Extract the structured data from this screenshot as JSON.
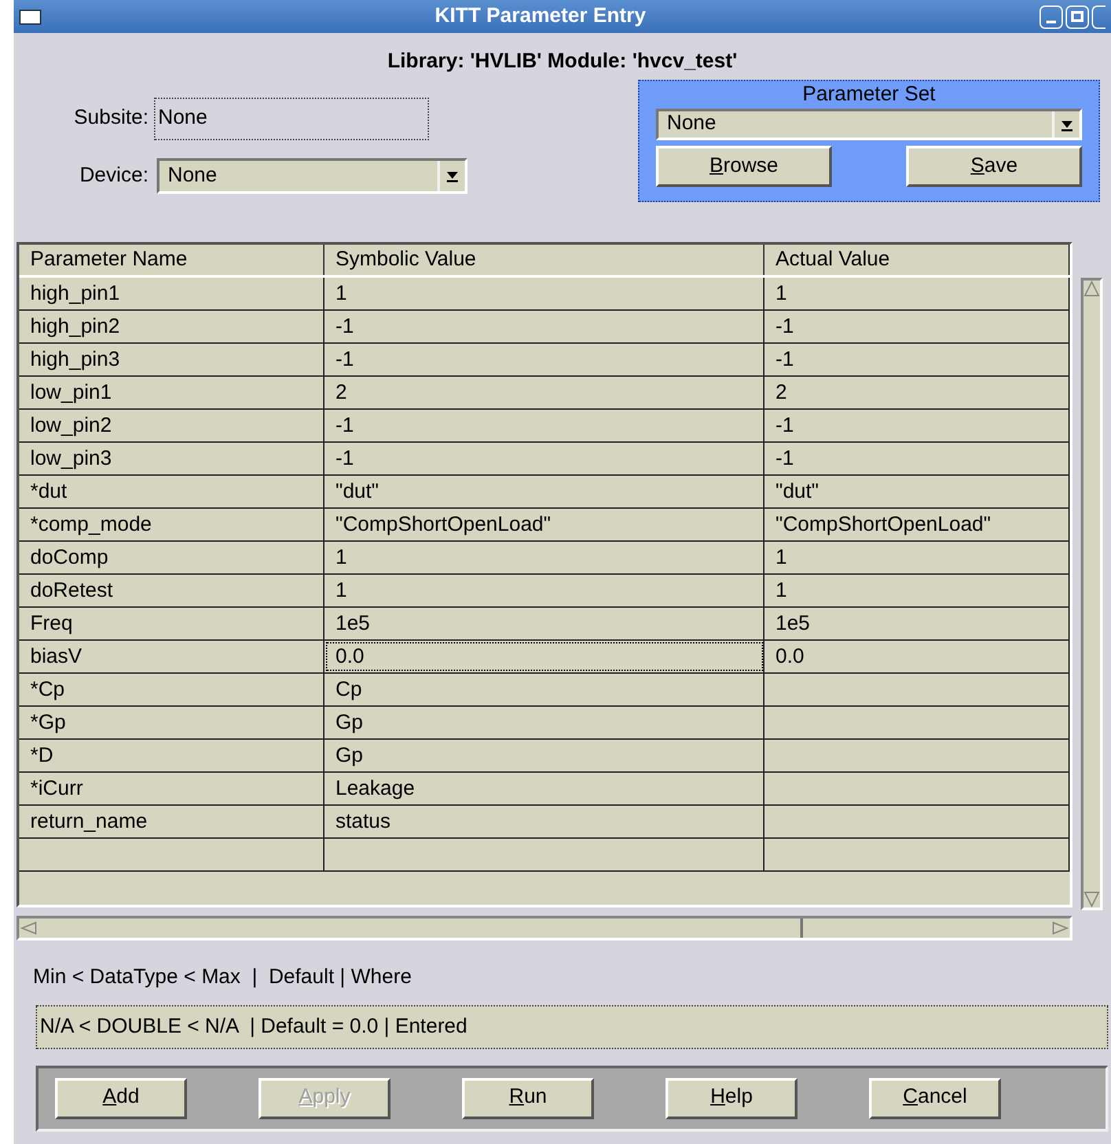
{
  "window": {
    "title": "KITT Parameter Entry"
  },
  "header": "Library: 'HVLIB'  Module: 'hvcv_test'",
  "subsite": {
    "label": "Subsite:",
    "value": "None"
  },
  "device": {
    "label": "Device:",
    "value": "None"
  },
  "parameter_set": {
    "title": "Parameter Set",
    "value": "None",
    "buttons": [
      {
        "label": "Browse"
      },
      {
        "label": "Save"
      }
    ]
  },
  "table": {
    "columns": [
      "Parameter Name",
      "Symbolic Value",
      "Actual Value"
    ],
    "rows": [
      {
        "cells": [
          "high_pin1",
          "1",
          "1"
        ],
        "focused": false
      },
      {
        "cells": [
          "high_pin2",
          "-1",
          "-1"
        ],
        "focused": false
      },
      {
        "cells": [
          "high_pin3",
          "-1",
          "-1"
        ],
        "focused": false
      },
      {
        "cells": [
          "low_pin1",
          "2",
          "2"
        ],
        "focused": false
      },
      {
        "cells": [
          "low_pin2",
          "-1",
          "-1"
        ],
        "focused": false
      },
      {
        "cells": [
          "low_pin3",
          "-1",
          "-1"
        ],
        "focused": false
      },
      {
        "cells": [
          "*dut",
          "\"dut\"",
          "\"dut\""
        ],
        "focused": false
      },
      {
        "cells": [
          "*comp_mode",
          "\"CompShortOpenLoad\"",
          "\"CompShortOpenLoad\""
        ],
        "focused": false
      },
      {
        "cells": [
          "doComp",
          "1",
          "1"
        ],
        "focused": false
      },
      {
        "cells": [
          "doRetest",
          "1",
          "1"
        ],
        "focused": false
      },
      {
        "cells": [
          "Freq",
          "1e5",
          "1e5"
        ],
        "focused": false
      },
      {
        "cells": [
          "biasV",
          "0.0",
          "0.0"
        ],
        "focused": true
      },
      {
        "cells": [
          "*Cp",
          "Cp",
          ""
        ],
        "focused": false
      },
      {
        "cells": [
          "*Gp",
          "Gp",
          ""
        ],
        "focused": false
      },
      {
        "cells": [
          "*D",
          "Gp",
          ""
        ],
        "focused": false
      },
      {
        "cells": [
          "*iCurr",
          "Leakage",
          ""
        ],
        "focused": false
      },
      {
        "cells": [
          "return_name",
          "status",
          ""
        ],
        "focused": false
      },
      {
        "cells": [
          "",
          "",
          ""
        ],
        "focused": false
      }
    ]
  },
  "info_label": "Min < DataType < Max  |  Default | Where",
  "info_value": "N/A < DOUBLE < N/A  | Default = 0.0 | Entered",
  "buttons": [
    {
      "label": "Add",
      "disabled": false
    },
    {
      "label": "Apply",
      "disabled": true
    },
    {
      "label": "Run",
      "disabled": false
    },
    {
      "label": "Help",
      "disabled": false
    },
    {
      "label": "Cancel",
      "disabled": false
    }
  ]
}
